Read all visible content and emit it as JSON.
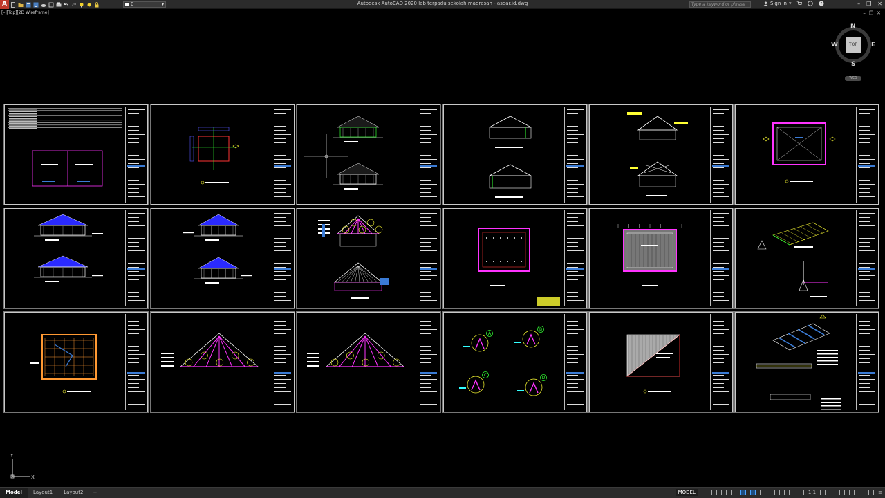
{
  "app": {
    "logo_letter": "A",
    "title": "Autodesk AutoCAD 2020   lab terpadu sekolah madrasah - asdar.id.dwg",
    "layer_value": "0",
    "search_placeholder": "Type a keyword or phrase",
    "sign_in": "Sign In",
    "win_min": "–",
    "win_restore": "❐",
    "win_close": "✕"
  },
  "viewport": {
    "label": "[–][Top][2D Wireframe]",
    "ctl_min": "–",
    "ctl_restore": "❐",
    "ctl_close": "✕"
  },
  "viewcube": {
    "top": "TOP",
    "north": "N",
    "south": "S",
    "east": "E",
    "west": "W",
    "wcs": "WCS"
  },
  "ucs": {
    "x": "X",
    "y": "Y"
  },
  "drawing_callouts": [
    "A",
    "B",
    "C",
    "D"
  ],
  "statusbar": {
    "tabs": [
      "Model",
      "Layout1",
      "Layout2"
    ],
    "add_tab": "+",
    "model_label": "MODEL",
    "scale": "1:1"
  }
}
